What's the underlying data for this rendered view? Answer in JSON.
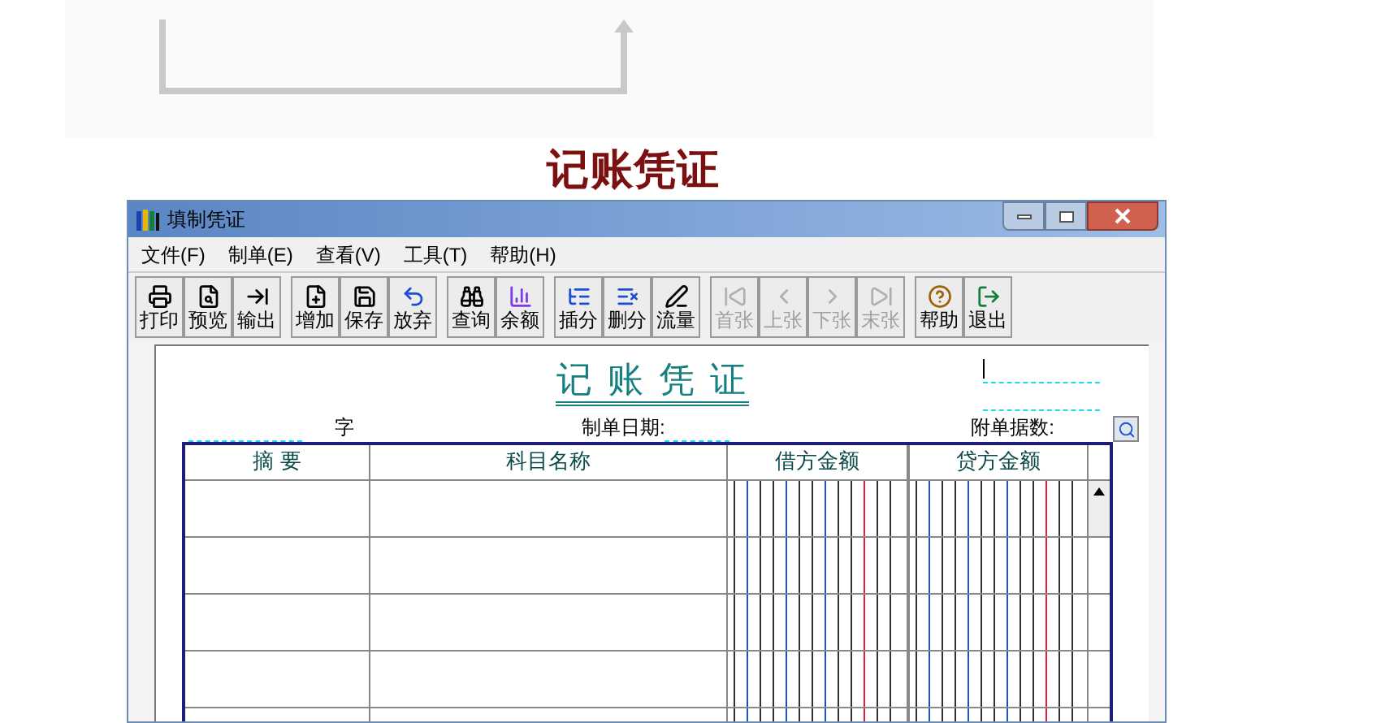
{
  "page_title": "记账凭证",
  "window": {
    "title": "填制凭证"
  },
  "menu": [
    "文件(F)",
    "制单(E)",
    "查看(V)",
    "工具(T)",
    "帮助(H)"
  ],
  "toolbar": [
    [
      {
        "label": "打印",
        "disabled": false
      },
      {
        "label": "预览",
        "disabled": false
      },
      {
        "label": "输出",
        "disabled": false
      }
    ],
    [
      {
        "label": "增加",
        "disabled": false
      },
      {
        "label": "保存",
        "disabled": false
      },
      {
        "label": "放弃",
        "disabled": false
      }
    ],
    [
      {
        "label": "查询",
        "disabled": false
      },
      {
        "label": "余额",
        "disabled": false
      }
    ],
    [
      {
        "label": "插分",
        "disabled": false
      },
      {
        "label": "删分",
        "disabled": false
      },
      {
        "label": "流量",
        "disabled": false
      }
    ],
    [
      {
        "label": "首张",
        "disabled": true
      },
      {
        "label": "上张",
        "disabled": true
      },
      {
        "label": "下张",
        "disabled": true
      },
      {
        "label": "末张",
        "disabled": true
      }
    ],
    [
      {
        "label": "帮助",
        "disabled": false
      },
      {
        "label": "退出",
        "disabled": false
      }
    ]
  ],
  "voucher": {
    "title": "记 账 凭 证",
    "word_label": "字",
    "date_label": "制单日期:",
    "attachments_label": "附单据数:",
    "columns": [
      "摘 要",
      "科目名称",
      "借方金额",
      "贷方金额"
    ]
  }
}
